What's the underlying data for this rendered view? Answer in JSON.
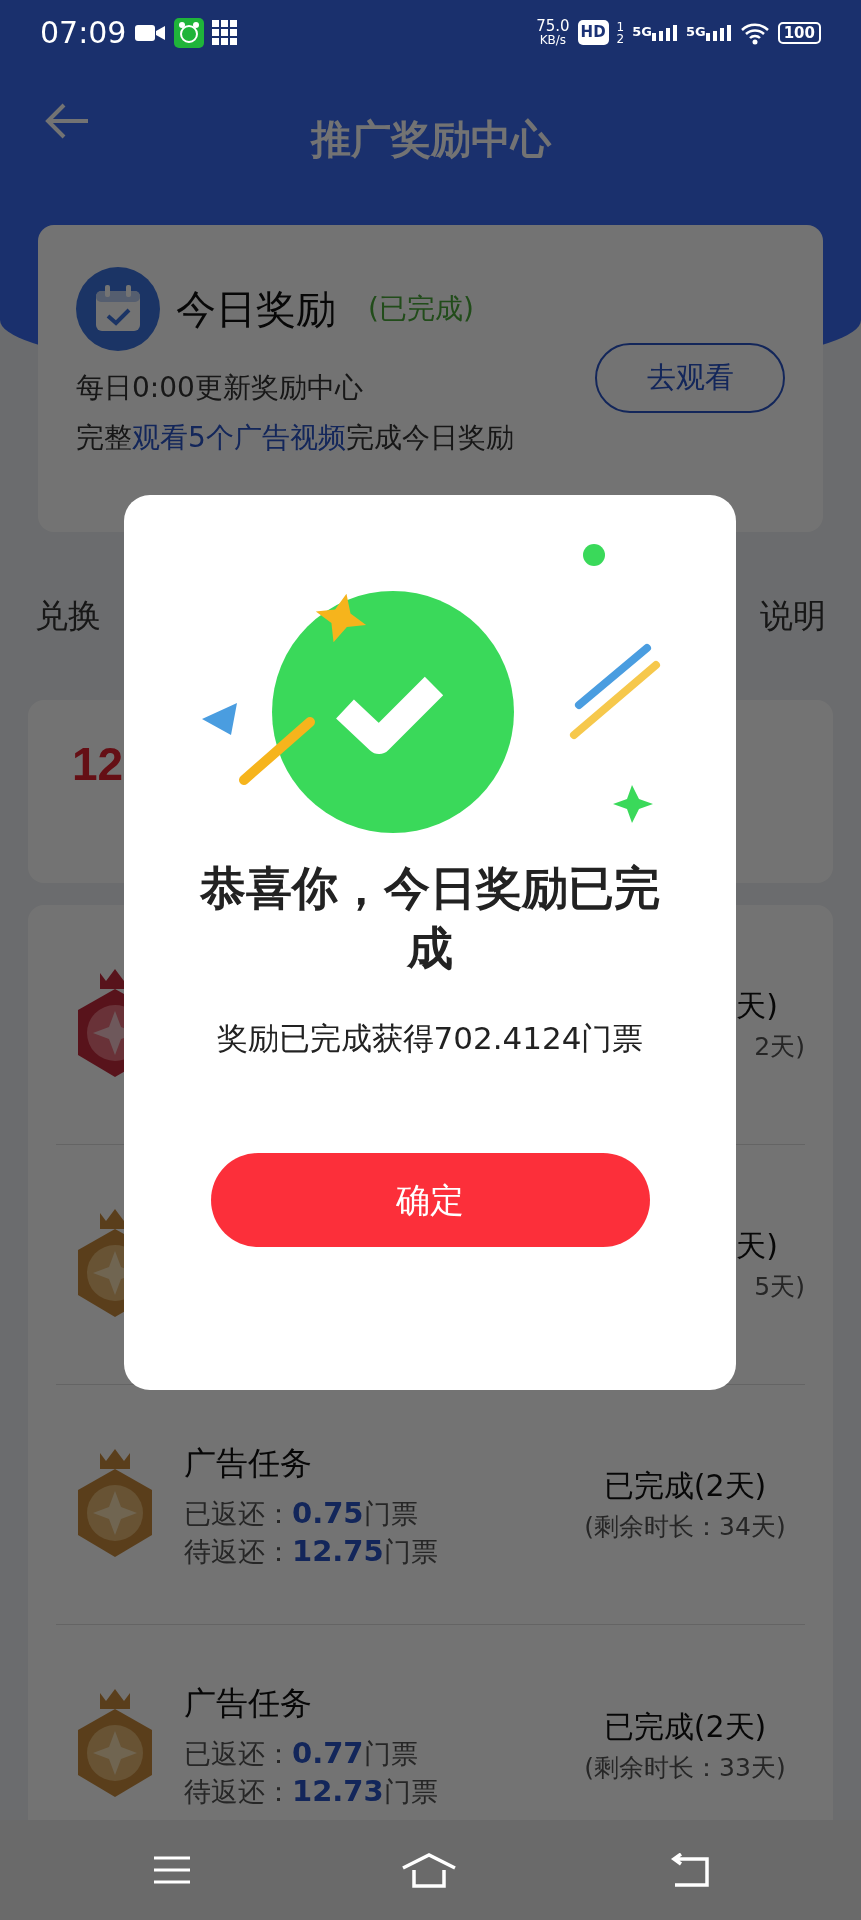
{
  "status_bar": {
    "time": "07:09",
    "net_speed": "75.0",
    "net_unit": "KB/s",
    "hd": "HD",
    "hd_sims": [
      "1",
      "2"
    ],
    "networks": [
      "5G",
      "5G"
    ],
    "battery": "100"
  },
  "header": {
    "title": "推广奖励中心"
  },
  "today_card": {
    "title": "今日奖励",
    "status": "(已完成)",
    "button": "去观看",
    "line_1": "每日0:00更新奖励中心",
    "line_2": {
      "before": "完整",
      "link": "观看5个广告视频",
      "after": "完成今日奖励"
    }
  },
  "section": {
    "left": "兑换",
    "right": "说明"
  },
  "summary_card": {
    "amount": "12"
  },
  "tasks": [
    {
      "kind": "ruby",
      "status": "天)",
      "remaining": "2天)"
    },
    {
      "kind": "gold",
      "status": "天)",
      "remaining": "5天)"
    },
    {
      "kind": "gold",
      "title": "广告任务",
      "returned_label": "已返还：",
      "returned": "0.75",
      "returned_unit": "门票",
      "pending_label": "待返还：",
      "pending": "12.75",
      "pending_unit": "门票",
      "status": "已完成(2天)",
      "remaining": "(剩余时长：34天)"
    },
    {
      "kind": "gold",
      "title": "广告任务",
      "returned_label": "已返还：",
      "returned": "0.77",
      "returned_unit": "门票",
      "pending_label": "待返还：",
      "pending": "12.73",
      "pending_unit": "门票",
      "status": "已完成(2天)",
      "remaining": "(剩余时长：33天)"
    }
  ],
  "dialog": {
    "title": "恭喜你，今日奖励已完成",
    "message": "奖励已完成获得702.4124门票",
    "button": "确定"
  }
}
